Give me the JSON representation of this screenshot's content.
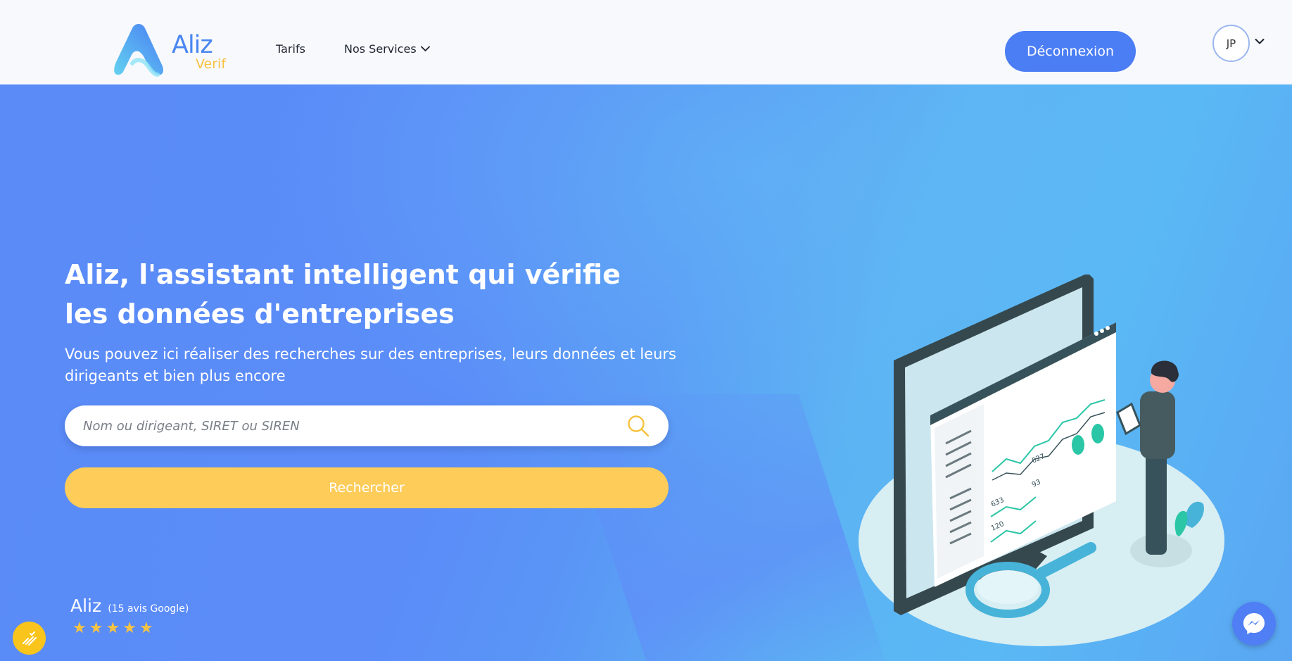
{
  "header": {
    "logo": {
      "name": "Aliz",
      "subtitle": "Verif"
    },
    "nav": {
      "tarifs": "Tarifs",
      "services": "Nos Services"
    },
    "logout_label": "Déconnexion",
    "avatar_initials": "JP"
  },
  "hero": {
    "title": "Aliz, l'assistant intelligent qui vérifie les données d'entreprises",
    "subtitle": "Vous pouvez ici réaliser des recherches sur des entreprises, leurs données et leurs dirigeants et bien plus encore",
    "search": {
      "placeholder": "Nom ou dirigeant, SIRET ou SIREN",
      "value": ""
    },
    "search_button": "Rechercher"
  },
  "reviews": {
    "name": "Aliz",
    "count_text": "(15 avis Google)",
    "rating": 5
  },
  "illustration": {
    "labels": [
      "627",
      "633",
      "93",
      "120"
    ]
  },
  "colors": {
    "primary": "#4b7df4",
    "accent_yellow": "#fdcc59",
    "header_bg": "#f7f9fd",
    "star": "#f6c343"
  },
  "icons": {
    "nav_dropdown": "chevron-down-icon",
    "search": "search-icon",
    "avatar_dropdown": "chevron-down-icon",
    "fab_left": "pencil-lines-icon",
    "fab_right": "messenger-icon"
  }
}
